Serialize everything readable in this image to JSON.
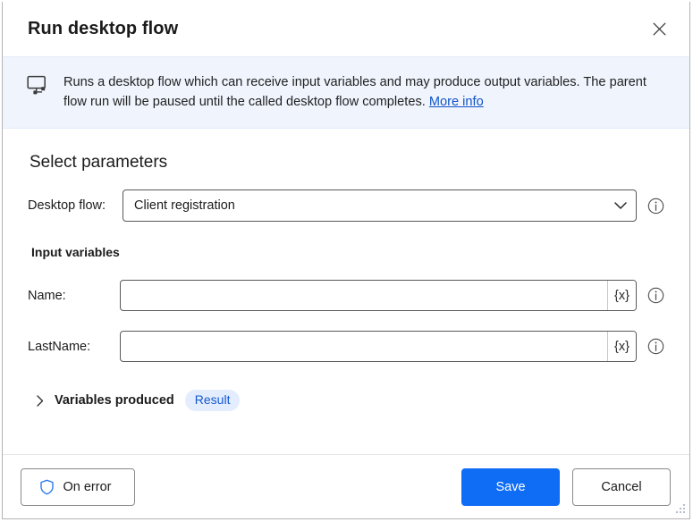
{
  "dialog": {
    "title": "Run desktop flow",
    "close_label": "Close"
  },
  "banner": {
    "icon": "desktop-flow-icon",
    "text": "Runs a desktop flow which can receive input variables and may produce output variables. The parent flow run will be paused until the called desktop flow completes.",
    "link_text": "More info"
  },
  "main": {
    "section_title": "Select parameters",
    "desktop_flow": {
      "label": "Desktop flow:",
      "value": "Client registration",
      "info_icon": "info-icon",
      "chevron_icon": "chevron-down-icon"
    },
    "input_variables": {
      "title": "Input variables",
      "fields": [
        {
          "label": "Name:",
          "value": "",
          "placeholder": "",
          "var_btn": "{x}",
          "info_icon": "info-icon"
        },
        {
          "label": "LastName:",
          "value": "",
          "placeholder": "",
          "var_btn": "{x}",
          "info_icon": "info-icon"
        }
      ]
    },
    "variables_produced": {
      "label": "Variables produced",
      "chevron_icon": "chevron-right-icon",
      "badge": "Result"
    }
  },
  "footer": {
    "on_error_label": "On error",
    "on_error_icon": "shield-icon",
    "save_label": "Save",
    "cancel_label": "Cancel"
  },
  "colors": {
    "primary": "#0f6cf5",
    "banner_bg": "#eff4fd",
    "link": "#1254c7",
    "badge_bg": "#e3edfd",
    "badge_text": "#1558cf",
    "shield": "#2b7cf0"
  }
}
